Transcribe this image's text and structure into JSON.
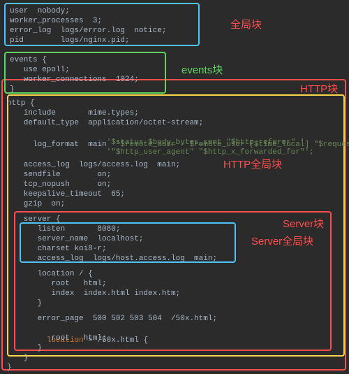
{
  "lines": {
    "l1": "user  nobody;",
    "l2": "worker_processes  3;",
    "l3": "error_log  logs/error.log  notice;",
    "l4": "pid        logs/nginx.pid;",
    "l5": "events {",
    "l6": "   use epoll;",
    "l7": "   worker_connections  1024;",
    "l8": "}",
    "l9": "http {",
    "l10": "   include       mime.types;",
    "l11": "   default_type  application/octet-stream;",
    "l12a": "   log_format  main  ",
    "l12b": "'$remote_addr - $remote_user [$time_local] \"$request\" '",
    "l13": "                     '$status $body_bytes_sent \"$http_referer\" '",
    "l14": "                     '\"$http_user_agent\" \"$http_x_forwarded_for\"';",
    "l15": "   access_log  logs/access.log  main;",
    "l16": "   sendfile        on;",
    "l17": "   tcp_nopush      on;",
    "l18": "   keepalive_timeout  65;",
    "l19": "   gzip  on;",
    "l20": "   server {",
    "l21": "      listen       8080;",
    "l22": "      server_name  localhost;",
    "l23": "      charset koi8-r;",
    "l24": "      access_log  logs/host.access.log  main;",
    "l25": "      location / {",
    "l26": "         root   html;",
    "l27": "         index  index.html index.htm;",
    "l28": "      }",
    "l29": "      error_page  500 502 503 504  /50x.html;",
    "l30a": "      ",
    "l30b": "location",
    "l30c": " = /50x.html {",
    "l31": "         root   html;",
    "l32": "      }",
    "l33": "   }",
    "l34": "}"
  },
  "labels": {
    "global": "全局块",
    "events": "events块",
    "http": "HTTP块",
    "http_global": "HTTP全局块",
    "server": "Server块",
    "server_global": "Server全局块"
  },
  "colors": {
    "blue": "#4fc3f7",
    "green": "#5fd35f",
    "red": "#ff4d4d",
    "yellow": "#ffd54f"
  }
}
